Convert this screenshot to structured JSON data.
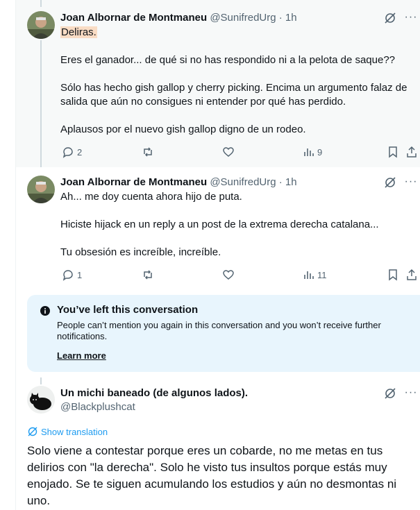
{
  "tweets": [
    {
      "author_name": "Joan Albornar de Montmaneu",
      "handle": "@SunifredUrg",
      "time": "· 1h",
      "highlight_word": "Deliras.",
      "paragraphs": [
        "Eres el ganador... de qué si no has respondido ni a la pelota de saque??",
        "Sólo has hecho gish gallop y cherry picking. Encima un argumento falaz de salida que aún no consigues ni entender por qué has perdido.",
        "Aplausos por el nuevo gish gallop digno de un rodeo."
      ],
      "replies": "2",
      "retweets": "",
      "likes": "",
      "views": "9"
    },
    {
      "author_name": "Joan Albornar de Montmaneu",
      "handle": "@SunifredUrg",
      "time": "· 1h",
      "paragraphs": [
        "Ah... me doy cuenta ahora hijo de puta.",
        "Hiciste hijack en un reply a un post de la extrema derecha catalana...",
        "Tu obsesión es increíble, increíble."
      ],
      "replies": "1",
      "retweets": "",
      "likes": "",
      "views": "11"
    }
  ],
  "notice": {
    "title": "You’ve left this conversation",
    "text": "People can’t mention you again in this conversation and you won’t receive further notifications.",
    "link": "Learn more"
  },
  "reply": {
    "author_name": "Un michi baneado (de algunos lados).",
    "handle": "@Blackplushcat",
    "translate_label": "Show translation",
    "text": "Solo viene a contestar porque eres un cobarde, no me metas en tus delirios con \"la derecha\". Solo he visto tus insultos porque estás muy enojado. Se te siguen acumulando los estudios y aún no desmontas ni uno."
  },
  "icons": {
    "more": "more-horizontal-icon",
    "grok": "grok-icon",
    "reply": "reply-icon",
    "retweet": "retweet-icon",
    "like": "heart-icon",
    "views": "views-icon",
    "bookmark": "bookmark-icon",
    "share": "share-icon",
    "info": "info-icon",
    "translate": "globe-icon"
  },
  "colors": {
    "text": "#0f1419",
    "muted": "#536471",
    "link": "#1d9bf0",
    "notice_bg": "#e8f5fd",
    "highlight_bg": "#f7f9f9",
    "highlight_word": "#f9dcc4"
  }
}
